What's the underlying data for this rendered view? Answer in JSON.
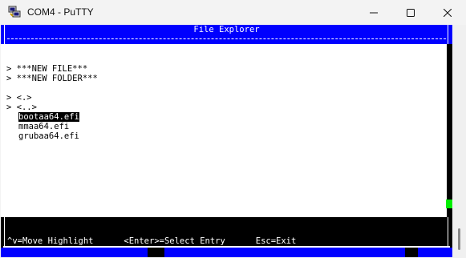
{
  "window": {
    "title": "COM4 - PuTTY",
    "app_icon": "putty-icon",
    "controls": [
      "minimize-icon",
      "maximize-icon",
      "close-icon"
    ]
  },
  "terminal": {
    "header_title": "File Explorer",
    "menu_items": [
      "> ***NEW FILE***",
      "> ***NEW FOLDER***"
    ],
    "dir_items": [
      "> <.>",
      "> <..>"
    ],
    "files": [
      "bootaa64.efi",
      "mmaa64.efi",
      "grubaa64.efi"
    ],
    "highlighted_file": "bootaa64.efi",
    "footer_hints": "^v=Move Highlight      <Enter>=Select Entry      Esc=Exit",
    "colors": {
      "header_bg": "#0000ff",
      "body_bg": "#ffffff",
      "cursor": "#00ee00",
      "terminal_bg": "#000000"
    }
  }
}
